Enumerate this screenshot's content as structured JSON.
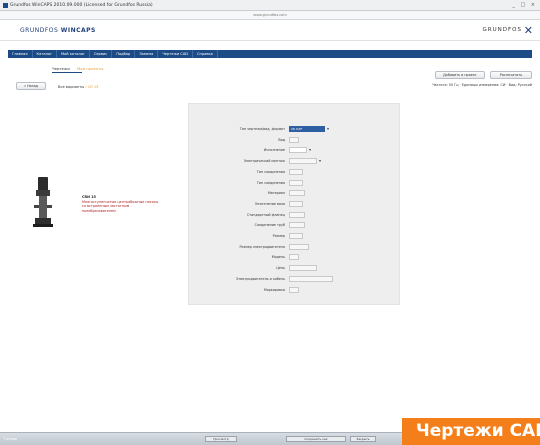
{
  "window": {
    "title": "Grundfos WinCAPS 2010.09.000 (Licensed for Grundfos Russia)",
    "url": "www.grundfos.com",
    "controls": "_ □ ×"
  },
  "header": {
    "brand_light": "GRUNDFOS",
    "brand_bold": "WINCAPS",
    "brand_right": "GRUNDFOS"
  },
  "nav": {
    "items": [
      "Главная",
      "Каталог",
      "Мой каталог",
      "Сервис",
      "Подбор",
      "Замена",
      "Чертежи CAD",
      "Справка"
    ]
  },
  "subtabs": {
    "active": "Чертежи",
    "other": "Мои проекты"
  },
  "toolbar": {
    "btn_add_project": "Добавить в проект",
    "btn_print": "Распечатать",
    "back": "« Назад",
    "info": "Частота: 50 Гц · Единицы измерения: СИ · Вид: Русский"
  },
  "breadcrumb": {
    "path": "Все варианты",
    "sep": " / ",
    "current": "CR 15"
  },
  "product": {
    "name": "CRN 15",
    "description": "Многоступенчатые центробежные насосы со встроенным частотным преобразователем"
  },
  "form": {
    "rows": [
      {
        "label": "Тип чертежа/вид, формат",
        "value": "2D DXF",
        "style": "sel-blue",
        "arrow": true
      },
      {
        "label": "Вид",
        "value": "",
        "style": ""
      },
      {
        "label": "Исполнение",
        "value": "",
        "style": "white",
        "arrow": true
      },
      {
        "label": "Электрический монтаж",
        "value": "",
        "style": "",
        "arrow": true
      },
      {
        "label": "Тип соединения",
        "value": "",
        "style": ""
      },
      {
        "label": "Тип соединения",
        "value": "",
        "style": ""
      },
      {
        "label": "Материал",
        "value": "",
        "style": ""
      },
      {
        "label": "Уплотнение вала",
        "value": "",
        "style": ""
      },
      {
        "label": "Стандартный фланец",
        "value": "",
        "style": ""
      },
      {
        "label": "Соединение труб",
        "value": "",
        "style": ""
      },
      {
        "label": "Размер",
        "value": "",
        "style": ""
      },
      {
        "label": "Размер электродвигателя",
        "value": "",
        "style": ""
      },
      {
        "label": "Модель",
        "value": "",
        "style": ""
      },
      {
        "label": "Цепь",
        "value": "",
        "style": ""
      },
      {
        "label": "Электродвигатель и кабель",
        "value": "",
        "style": ""
      },
      {
        "label": "Маркировка",
        "value": "",
        "style": ""
      }
    ]
  },
  "statusbar": {
    "status": "Готово",
    "buttons": [
      "Просмотр",
      "Сохранить как",
      "Закрыть"
    ]
  },
  "watermark": "Чертежи CAD",
  "colors": {
    "nav_blue": "#1d4b86",
    "accent_orange": "#f47e1a",
    "panel_gray": "#eeeeee"
  }
}
